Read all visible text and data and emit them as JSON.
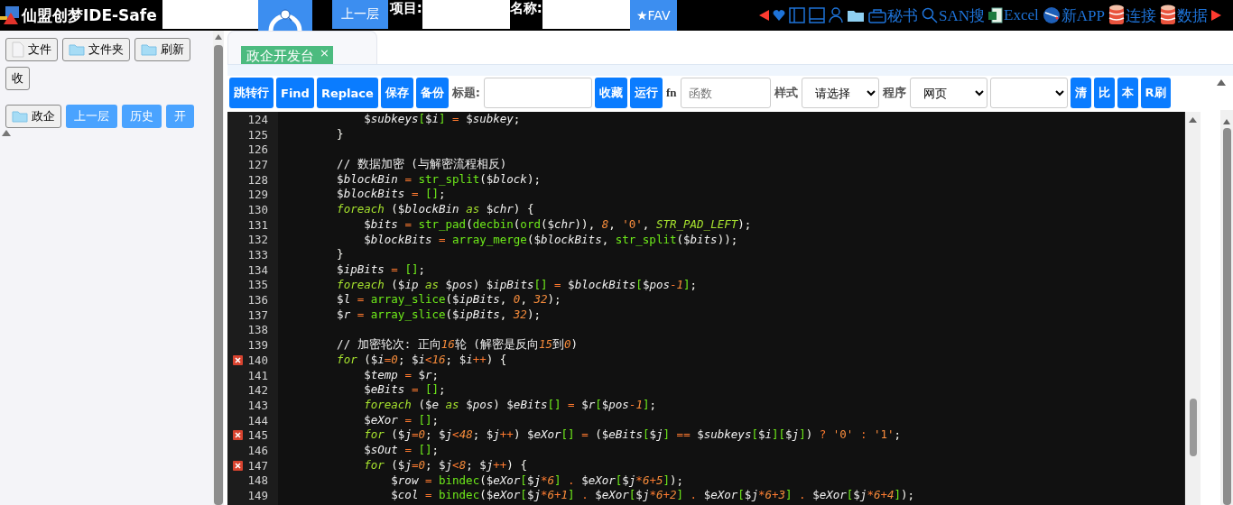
{
  "app_bar": {
    "title": "仙盟创梦IDE-Safe",
    "up_button": "上一层",
    "project_label": "项目:",
    "name_label": "名称:",
    "fav_button": "★FAV",
    "links": [
      {
        "kind": "arrow-left"
      },
      {
        "kind": "heart"
      },
      {
        "kind": "panel-left"
      },
      {
        "kind": "panel-bottom"
      },
      {
        "kind": "person"
      },
      {
        "kind": "folder"
      },
      {
        "kind": "bag",
        "label": "秘书"
      },
      {
        "kind": "search",
        "label": "SAN搜"
      },
      {
        "kind": "excel",
        "label": "Excel"
      },
      {
        "kind": "globe",
        "label": "新APP"
      },
      {
        "kind": "database",
        "label": "连接"
      },
      {
        "kind": "database",
        "label": "数据"
      },
      {
        "kind": "arrow-right"
      }
    ]
  },
  "sidebar": {
    "file_buttons": [
      {
        "label": "文件",
        "kind": "file"
      },
      {
        "label": "文件夹",
        "kind": "folder"
      },
      {
        "label": "刷新",
        "kind": "folder"
      },
      {
        "label": "收",
        "kind": "plain"
      }
    ],
    "nav_buttons": [
      {
        "label": "政企",
        "kind": "folder"
      },
      {
        "label": "上一层",
        "kind": "primary"
      },
      {
        "label": "历史",
        "kind": "primary"
      },
      {
        "label": "开",
        "kind": "primary"
      }
    ]
  },
  "tabs": [
    {
      "label": "政企开发台",
      "close": "×",
      "selected": true
    }
  ],
  "toolbar": [
    {
      "kind": "button",
      "label": "跳转行"
    },
    {
      "kind": "button",
      "label": "Find"
    },
    {
      "kind": "button",
      "label": "Replace"
    },
    {
      "kind": "button",
      "label": "保存"
    },
    {
      "kind": "button",
      "label": "备份"
    },
    {
      "kind": "label",
      "label": "标题:"
    },
    {
      "kind": "input"
    },
    {
      "kind": "button",
      "label": "收藏"
    },
    {
      "kind": "button",
      "label": "运行"
    },
    {
      "kind": "label",
      "label": "fn"
    },
    {
      "kind": "input",
      "placeholder": "函数"
    },
    {
      "kind": "label",
      "label": "样式"
    },
    {
      "kind": "select",
      "value": "请选择"
    },
    {
      "kind": "label",
      "label": "程序"
    },
    {
      "kind": "select",
      "value": "网页"
    },
    {
      "kind": "select"
    },
    {
      "kind": "button",
      "label": "清"
    },
    {
      "kind": "button",
      "label": "比"
    },
    {
      "kind": "button",
      "label": "本"
    },
    {
      "kind": "button",
      "label": "R刷"
    }
  ],
  "editor": {
    "lines": [
      {
        "number": "124",
        "code": "        $subkeys[$i] = $subkey;",
        "error": false
      },
      {
        "number": "125",
        "code": "    }",
        "error": false
      },
      {
        "number": "126",
        "error": false
      },
      {
        "number": "127",
        "code": "    // 数据加密 (与解密流程相反)",
        "error": false
      },
      {
        "number": "128",
        "code": "    $blockBin = str_split($block);",
        "error": false
      },
      {
        "number": "129",
        "code": "    $blockBits = [];",
        "error": false
      },
      {
        "number": "130",
        "code": "    foreach ($blockBin as $chr) {",
        "error": false
      },
      {
        "number": "131",
        "code": "        $bits = str_pad(decbin(ord($chr)), 8, '0', STR_PAD_LEFT);",
        "error": false
      },
      {
        "number": "132",
        "code": "        $blockBits = array_merge($blockBits, str_split($bits));",
        "error": false
      },
      {
        "number": "133",
        "code": "    }",
        "error": false
      },
      {
        "number": "134",
        "code": "    $ipBits = [];",
        "error": false
      },
      {
        "number": "135",
        "code": "    foreach ($ip as $pos) $ipBits[] = $blockBits[$pos-1];",
        "error": false
      },
      {
        "number": "136",
        "code": "    $l = array_slice($ipBits, 0, 32);",
        "error": false
      },
      {
        "number": "137",
        "code": "    $r = array_slice($ipBits, 32);",
        "error": false
      },
      {
        "number": "138",
        "error": false
      },
      {
        "number": "139",
        "code": "    // 加密轮次: 正向16轮 (解密是反向15到0)",
        "error": false
      },
      {
        "number": "140",
        "code": "    for ($i=0; $i<16; $i++) {",
        "error": true
      },
      {
        "number": "141",
        "code": "        $temp = $r;",
        "error": false
      },
      {
        "number": "142",
        "code": "        $eBits = [];",
        "error": false
      },
      {
        "number": "143",
        "code": "        foreach ($e as $pos) $eBits[] = $r[$pos-1];",
        "error": false
      },
      {
        "number": "144",
        "code": "        $eXor = [];",
        "error": false
      },
      {
        "number": "145",
        "code": "        for ($j=0; $j<48; $j++) $eXor[] = ($eBits[$j] == $subkeys[$i][$j]) ? '0' : '1';",
        "error": true
      },
      {
        "number": "146",
        "code": "        $sOut = [];",
        "error": false
      },
      {
        "number": "147",
        "code": "        for ($j=0; $j<8; $j++) {",
        "error": true
      },
      {
        "number": "148",
        "code": "            $row = bindec($eXor[$j*6] . $eXor[$j*6+5]);",
        "error": false
      },
      {
        "number": "149",
        "code": "            $col = bindec($eXor[$j*6+1] . $eXor[$j*6+2] . $eXor[$j*6+3] . $eXor[$j*6+4]);",
        "error": false
      }
    ]
  }
}
